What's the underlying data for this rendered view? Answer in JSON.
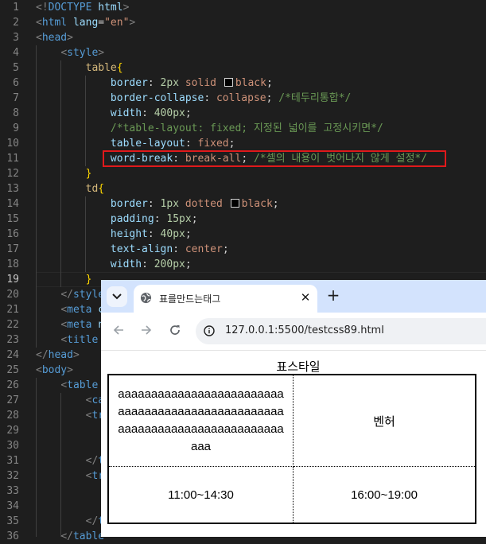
{
  "editor": {
    "current_line": 19,
    "lines": [
      {
        "n": 1,
        "tokens": [
          [
            "punc",
            "<!"
          ],
          [
            "tag",
            "DOCTYPE"
          ],
          [
            "plain",
            " "
          ],
          [
            "attr",
            "html"
          ],
          [
            "punc",
            ">"
          ]
        ]
      },
      {
        "n": 2,
        "tokens": [
          [
            "punc",
            "<"
          ],
          [
            "tag",
            "html"
          ],
          [
            "plain",
            " "
          ],
          [
            "attr",
            "lang"
          ],
          [
            "plain",
            "="
          ],
          [
            "str",
            "\"en\""
          ],
          [
            "punc",
            ">"
          ]
        ]
      },
      {
        "n": 3,
        "tokens": [
          [
            "punc",
            "<"
          ],
          [
            "tag",
            "head"
          ],
          [
            "punc",
            ">"
          ]
        ]
      },
      {
        "n": 4,
        "tokens": [
          [
            "plain",
            "    "
          ],
          [
            "punc",
            "<"
          ],
          [
            "tag",
            "style"
          ],
          [
            "punc",
            ">"
          ]
        ]
      },
      {
        "n": 5,
        "tokens": [
          [
            "plain",
            "        "
          ],
          [
            "sel",
            "table"
          ],
          [
            "brace",
            "{"
          ]
        ]
      },
      {
        "n": 6,
        "tokens": [
          [
            "plain",
            "            "
          ],
          [
            "prop",
            "border"
          ],
          [
            "plain",
            ": "
          ],
          [
            "num",
            "2px"
          ],
          [
            "plain",
            " "
          ],
          [
            "val",
            "solid"
          ],
          [
            "plain",
            " "
          ],
          [
            "swatch",
            ""
          ],
          [
            "val",
            "black"
          ],
          [
            "plain",
            ";"
          ]
        ]
      },
      {
        "n": 7,
        "tokens": [
          [
            "plain",
            "            "
          ],
          [
            "prop",
            "border-collapse"
          ],
          [
            "plain",
            ": "
          ],
          [
            "val",
            "collapse"
          ],
          [
            "plain",
            "; "
          ],
          [
            "com",
            "/*테두리통합*/"
          ]
        ]
      },
      {
        "n": 8,
        "tokens": [
          [
            "plain",
            "            "
          ],
          [
            "prop",
            "width"
          ],
          [
            "plain",
            ": "
          ],
          [
            "num",
            "400px"
          ],
          [
            "plain",
            ";"
          ]
        ]
      },
      {
        "n": 9,
        "tokens": [
          [
            "plain",
            "            "
          ],
          [
            "com",
            "/*table-layout: fixed; 지정된 넓이를 고정시키면*/"
          ]
        ]
      },
      {
        "n": 10,
        "tokens": [
          [
            "plain",
            "            "
          ],
          [
            "prop",
            "table-layout"
          ],
          [
            "plain",
            ": "
          ],
          [
            "val",
            "fixed"
          ],
          [
            "plain",
            ";"
          ]
        ]
      },
      {
        "n": 11,
        "tokens": [
          [
            "plain",
            "            "
          ],
          [
            "prop",
            "word-break"
          ],
          [
            "plain",
            ": "
          ],
          [
            "val",
            "break-all"
          ],
          [
            "plain",
            "; "
          ],
          [
            "com",
            "/*셀의 내용이 벗어나지 않게 설정*/"
          ]
        ]
      },
      {
        "n": 12,
        "tokens": [
          [
            "plain",
            "        "
          ],
          [
            "brace",
            "}"
          ]
        ]
      },
      {
        "n": 13,
        "tokens": [
          [
            "plain",
            "        "
          ],
          [
            "sel",
            "td"
          ],
          [
            "brace",
            "{"
          ]
        ]
      },
      {
        "n": 14,
        "tokens": [
          [
            "plain",
            "            "
          ],
          [
            "prop",
            "border"
          ],
          [
            "plain",
            ": "
          ],
          [
            "num",
            "1px"
          ],
          [
            "plain",
            " "
          ],
          [
            "val",
            "dotted"
          ],
          [
            "plain",
            " "
          ],
          [
            "swatch",
            ""
          ],
          [
            "val",
            "black"
          ],
          [
            "plain",
            ";"
          ]
        ]
      },
      {
        "n": 15,
        "tokens": [
          [
            "plain",
            "            "
          ],
          [
            "prop",
            "padding"
          ],
          [
            "plain",
            ": "
          ],
          [
            "num",
            "15px"
          ],
          [
            "plain",
            ";"
          ]
        ]
      },
      {
        "n": 16,
        "tokens": [
          [
            "plain",
            "            "
          ],
          [
            "prop",
            "height"
          ],
          [
            "plain",
            ": "
          ],
          [
            "num",
            "40px"
          ],
          [
            "plain",
            ";"
          ]
        ]
      },
      {
        "n": 17,
        "tokens": [
          [
            "plain",
            "            "
          ],
          [
            "prop",
            "text-align"
          ],
          [
            "plain",
            ": "
          ],
          [
            "val",
            "center"
          ],
          [
            "plain",
            ";"
          ]
        ]
      },
      {
        "n": 18,
        "tokens": [
          [
            "plain",
            "            "
          ],
          [
            "prop",
            "width"
          ],
          [
            "plain",
            ": "
          ],
          [
            "num",
            "200px"
          ],
          [
            "plain",
            ";"
          ]
        ]
      },
      {
        "n": 19,
        "tokens": [
          [
            "plain",
            "        "
          ],
          [
            "brace",
            "}"
          ]
        ]
      },
      {
        "n": 20,
        "tokens": [
          [
            "plain",
            "    "
          ],
          [
            "punc",
            "</"
          ],
          [
            "tag",
            "style"
          ]
        ]
      },
      {
        "n": 21,
        "tokens": [
          [
            "plain",
            "    "
          ],
          [
            "punc",
            "<"
          ],
          [
            "tag",
            "meta"
          ],
          [
            "plain",
            " "
          ],
          [
            "attr",
            "c"
          ]
        ]
      },
      {
        "n": 22,
        "tokens": [
          [
            "plain",
            "    "
          ],
          [
            "punc",
            "<"
          ],
          [
            "tag",
            "meta"
          ],
          [
            "plain",
            " "
          ],
          [
            "attr",
            "n"
          ]
        ]
      },
      {
        "n": 23,
        "tokens": [
          [
            "plain",
            "    "
          ],
          [
            "punc",
            "<"
          ],
          [
            "tag",
            "title"
          ]
        ]
      },
      {
        "n": 24,
        "tokens": [
          [
            "punc",
            "</"
          ],
          [
            "tag",
            "head"
          ],
          [
            "punc",
            ">"
          ]
        ]
      },
      {
        "n": 25,
        "tokens": [
          [
            "punc",
            "<"
          ],
          [
            "tag",
            "body"
          ],
          [
            "punc",
            ">"
          ]
        ]
      },
      {
        "n": 26,
        "tokens": [
          [
            "plain",
            "    "
          ],
          [
            "punc",
            "<"
          ],
          [
            "tag",
            "table"
          ]
        ]
      },
      {
        "n": 27,
        "tokens": [
          [
            "plain",
            "        "
          ],
          [
            "punc",
            "<"
          ],
          [
            "tag",
            "ca"
          ]
        ]
      },
      {
        "n": 28,
        "tokens": [
          [
            "plain",
            "        "
          ],
          [
            "punc",
            "<"
          ],
          [
            "tag",
            "tr"
          ]
        ]
      },
      {
        "n": 29,
        "tokens": []
      },
      {
        "n": 30,
        "tokens": []
      },
      {
        "n": 31,
        "tokens": [
          [
            "plain",
            "        "
          ],
          [
            "punc",
            "</"
          ],
          [
            "tag",
            "t"
          ]
        ]
      },
      {
        "n": 32,
        "tokens": [
          [
            "plain",
            "        "
          ],
          [
            "punc",
            "<"
          ],
          [
            "tag",
            "tr"
          ]
        ]
      },
      {
        "n": 33,
        "tokens": []
      },
      {
        "n": 34,
        "tokens": []
      },
      {
        "n": 35,
        "tokens": [
          [
            "plain",
            "        "
          ],
          [
            "punc",
            "</"
          ],
          [
            "tag",
            "t"
          ]
        ]
      },
      {
        "n": 36,
        "tokens": [
          [
            "plain",
            "    "
          ],
          [
            "punc",
            "</"
          ],
          [
            "tag",
            "table"
          ]
        ]
      }
    ]
  },
  "browser": {
    "tab_title": "표를만드는태그",
    "url": "127.0.0.1:5500/testcss89.html",
    "tab_icon": "globe-icon",
    "close_icon": "close-icon",
    "new_tab_icon": "plus-icon"
  },
  "page": {
    "caption": "표스타일",
    "rows": [
      [
        "aaaaaaaaaaaaaaaaaaaaaaaaaaaaaaaaaaaaaaaaaaaaaaaaaaaaaaaaaaaaaaaaaaaaaaaaaaaaaa",
        "벤허"
      ],
      [
        "11:00~14:30",
        "16:00~19:00"
      ]
    ]
  }
}
